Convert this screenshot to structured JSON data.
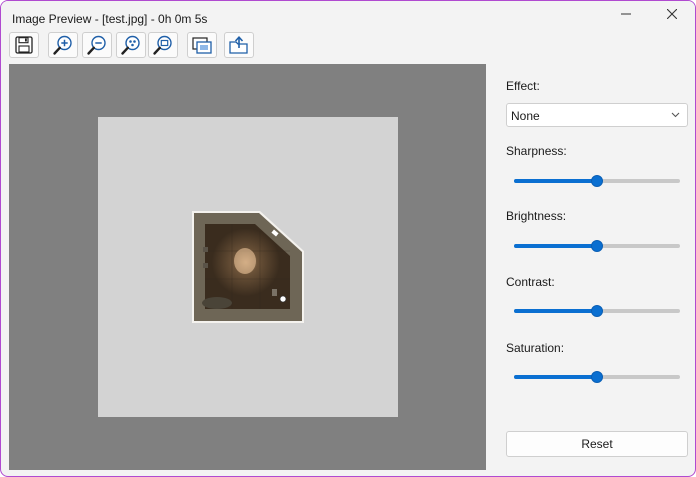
{
  "window": {
    "title": "Image Preview - [test.jpg] - 0h 0m 5s",
    "controls": [
      "minimize-icon",
      "close-icon"
    ]
  },
  "toolbar": {
    "buttons": [
      {
        "icon": "save-icon"
      },
      {
        "icon": "zoom-in-icon"
      },
      {
        "icon": "zoom-out-icon"
      },
      {
        "icon": "zoom-fit-icon"
      },
      {
        "icon": "zoom-actual-icon"
      },
      {
        "icon": "fit-window-icon"
      },
      {
        "icon": "export-icon"
      }
    ]
  },
  "viewer": {
    "viewport_color": "#808080",
    "canvas_color": "#d3d3d3",
    "image_description_icon": "room-photo"
  },
  "panel": {
    "effect_label": "Effect:",
    "effect_value": "None",
    "sliders": [
      {
        "label": "Sharpness:",
        "value": 0.5
      },
      {
        "label": "Brightness:",
        "value": 0.5
      },
      {
        "label": "Contrast:",
        "value": 0.5
      },
      {
        "label": "Saturation:",
        "value": 0.5
      }
    ],
    "reset_label": "Reset",
    "accent_color": "#0a6fd1"
  }
}
